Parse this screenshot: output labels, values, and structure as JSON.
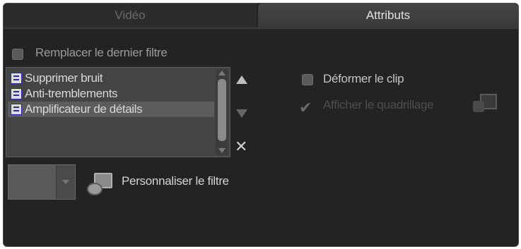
{
  "tabs": {
    "video": "Vidéo",
    "attributs": "Attributs"
  },
  "replace_last_filter": {
    "label": "Remplacer le dernier filtre",
    "checked": false
  },
  "filter_list": {
    "items": [
      {
        "label": "Supprimer bruit",
        "selected": false,
        "icon": "filter-icon"
      },
      {
        "label": "Anti-tremblements",
        "selected": false,
        "icon": "filter-icon"
      },
      {
        "label": "Amplificateur de détails",
        "selected": true,
        "icon": "filter-icon"
      }
    ]
  },
  "buttons": {
    "move_up": "▲",
    "move_down": "▼",
    "delete": "✕"
  },
  "customize": {
    "label": "Personnaliser le filtre",
    "icon": "customize-filter-icon"
  },
  "deform_clip": {
    "label": "Déformer le clip",
    "checked": false
  },
  "show_mask": {
    "label": "Afficher le quadrillage",
    "checked": true,
    "enabled": false,
    "icon": "grid-mask-icon"
  },
  "colors": {
    "background": "#232323",
    "selection": "#5c5c5c",
    "active_tab": "#3f3f3f"
  }
}
